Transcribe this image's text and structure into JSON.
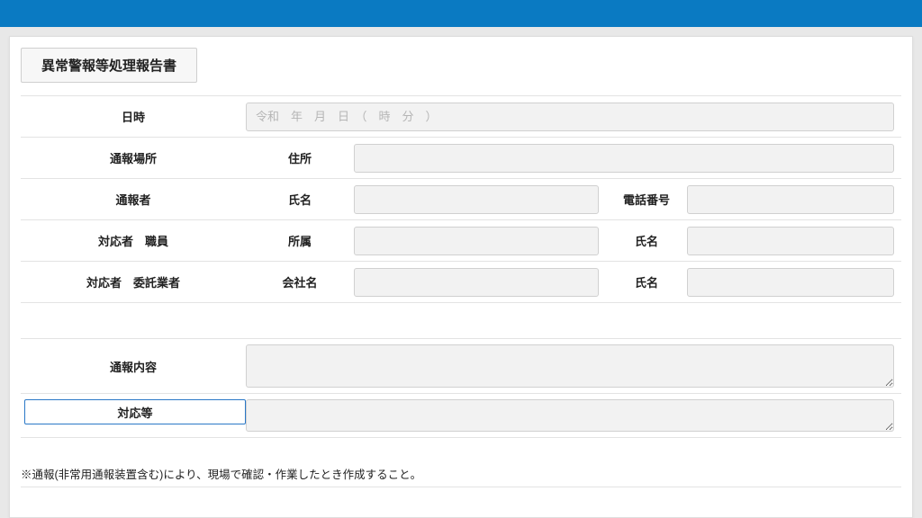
{
  "form_title": "異常警報等処理報告書",
  "rows": {
    "datetime": {
      "label": "日時",
      "placeholder": "令和　年　月　日　（　時　分　）",
      "value": ""
    },
    "location": {
      "label": "通報場所",
      "sub": "住所",
      "value": ""
    },
    "reporter": {
      "label": "通報者",
      "name_sub": "氏名",
      "name_value": "",
      "phone_sub": "電話番号",
      "phone_value": ""
    },
    "responder_staff": {
      "label": "対応者　職員",
      "dept_sub": "所属",
      "dept_value": "",
      "name_sub": "氏名",
      "name_value": ""
    },
    "responder_contractor": {
      "label": "対応者　委託業者",
      "company_sub": "会社名",
      "company_value": "",
      "name_sub": "氏名",
      "name_value": ""
    },
    "report_content": {
      "label": "通報内容",
      "value": ""
    },
    "response": {
      "label": "対応等",
      "value": ""
    }
  },
  "footer_note": "※通報(非常用通報装置含む)により、現場で確認・作業したとき作成すること。"
}
